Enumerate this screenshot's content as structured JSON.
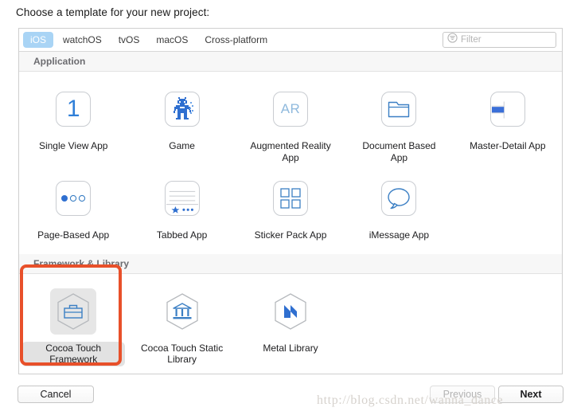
{
  "sheet": {
    "title": "Choose a template for your new project:"
  },
  "toolbar": {
    "tabs": [
      {
        "label": "iOS",
        "active": true
      },
      {
        "label": "watchOS",
        "active": false
      },
      {
        "label": "tvOS",
        "active": false
      },
      {
        "label": "macOS",
        "active": false
      },
      {
        "label": "Cross-platform",
        "active": false
      }
    ],
    "filter": {
      "placeholder": "Filter",
      "value": "",
      "icon": "filter-circle-icon"
    }
  },
  "sections": [
    {
      "header": "Application",
      "rows": [
        [
          {
            "label": "Single View App",
            "icon": "single-view-app-icon",
            "selected": false
          },
          {
            "label": "Game",
            "icon": "game-robot-icon",
            "selected": false
          },
          {
            "label": "Augmented Reality App",
            "icon": "augmented-reality-app-icon",
            "selected": false
          },
          {
            "label": "Document Based App",
            "icon": "document-folder-icon",
            "selected": false
          },
          {
            "label": "Master-Detail App",
            "icon": "master-detail-app-icon",
            "selected": false
          }
        ],
        [
          {
            "label": "Page-Based App",
            "icon": "page-dots-icon",
            "selected": false
          },
          {
            "label": "Tabbed App",
            "icon": "tab-bar-icon",
            "selected": false
          },
          {
            "label": "Sticker Pack App",
            "icon": "sticker-grid-icon",
            "selected": false
          },
          {
            "label": "iMessage App",
            "icon": "speech-bubble-icon",
            "selected": false
          }
        ]
      ]
    },
    {
      "header": "Framework & Library",
      "rows": [
        [
          {
            "label": "Cocoa Touch Framework",
            "icon": "toolbox-hexagon-icon",
            "selected": true
          },
          {
            "label": "Cocoa Touch Static Library",
            "icon": "bank-hexagon-icon",
            "selected": false
          },
          {
            "label": "Metal Library",
            "icon": "metal-m-hexagon-icon",
            "selected": false
          }
        ]
      ]
    }
  ],
  "footer": {
    "cancel": "Cancel",
    "previous": "Previous",
    "next": "Next"
  },
  "watermark": "http://blog.csdn.net/wanna_dance",
  "colors": {
    "accent_blue": "#2f7fd8",
    "tab_active_bg": "#a9d4f5",
    "annotation_red": "#e8502a",
    "selection_gray": "#e2e2e2",
    "icon_outline": "#3b7fc4",
    "hex_outline": "#b6b9bd"
  }
}
